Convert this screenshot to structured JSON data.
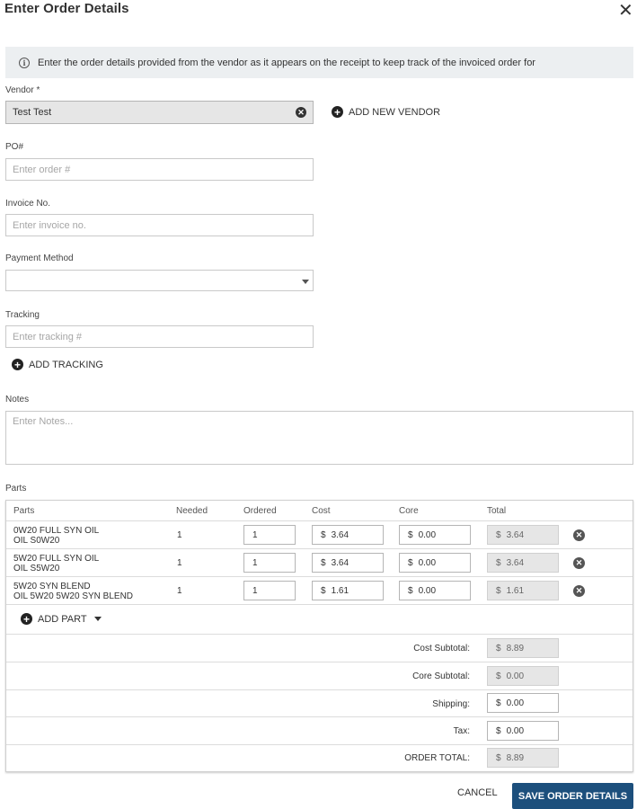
{
  "dialog": {
    "title": "Enter Order Details",
    "close_icon": "close-icon"
  },
  "info_banner": {
    "text": "Enter the order details provided from the vendor as it appears on the receipt to keep track of the invoiced order for",
    "icon": "info-icon"
  },
  "vendor": {
    "label": "Vendor *",
    "value": "Test Test",
    "add_new_label": "ADD NEW VENDOR"
  },
  "po": {
    "label": "PO#",
    "placeholder": "Enter order #"
  },
  "invoice": {
    "label": "Invoice No.",
    "placeholder": "Enter invoice no."
  },
  "payment": {
    "label": "Payment Method",
    "value": ""
  },
  "tracking": {
    "label": "Tracking",
    "placeholder": "Enter tracking #",
    "add_label": "ADD TRACKING"
  },
  "notes": {
    "label": "Notes",
    "placeholder": "Enter Notes..."
  },
  "parts": {
    "section_label": "Parts",
    "headers": {
      "parts": "Parts",
      "needed": "Needed",
      "ordered": "Ordered",
      "cost": "Cost",
      "core": "Core",
      "total": "Total"
    },
    "currency_symbol": "$",
    "rows": [
      {
        "name": "0W20 FULL SYN OIL",
        "subname": "OIL S0W20",
        "needed": "1",
        "ordered": "1",
        "cost": "3.64",
        "core": "0.00",
        "total": "3.64"
      },
      {
        "name": "5W20 FULL SYN OIL",
        "subname": "OIL S5W20",
        "needed": "1",
        "ordered": "1",
        "cost": "3.64",
        "core": "0.00",
        "total": "3.64"
      },
      {
        "name": "5W20 SYN BLEND",
        "subname": "OIL 5W20 5W20 SYN BLEND",
        "needed": "1",
        "ordered": "1",
        "cost": "1.61",
        "core": "0.00",
        "total": "1.61"
      }
    ],
    "add_part_label": "ADD PART",
    "summary": {
      "cost_subtotal_label": "Cost Subtotal:",
      "cost_subtotal": "8.89",
      "core_subtotal_label": "Core Subtotal:",
      "core_subtotal": "0.00",
      "shipping_label": "Shipping:",
      "shipping": "0.00",
      "tax_label": "Tax:",
      "tax": "0.00",
      "order_total_label": "ORDER TOTAL:",
      "order_total": "8.89"
    }
  },
  "footer": {
    "cancel_label": "CANCEL",
    "save_label": "SAVE ORDER DETAILS"
  },
  "colors": {
    "primary": "#1c4f7c",
    "banner_bg": "#eceff1",
    "readonly_bg": "#e6e6e6"
  }
}
